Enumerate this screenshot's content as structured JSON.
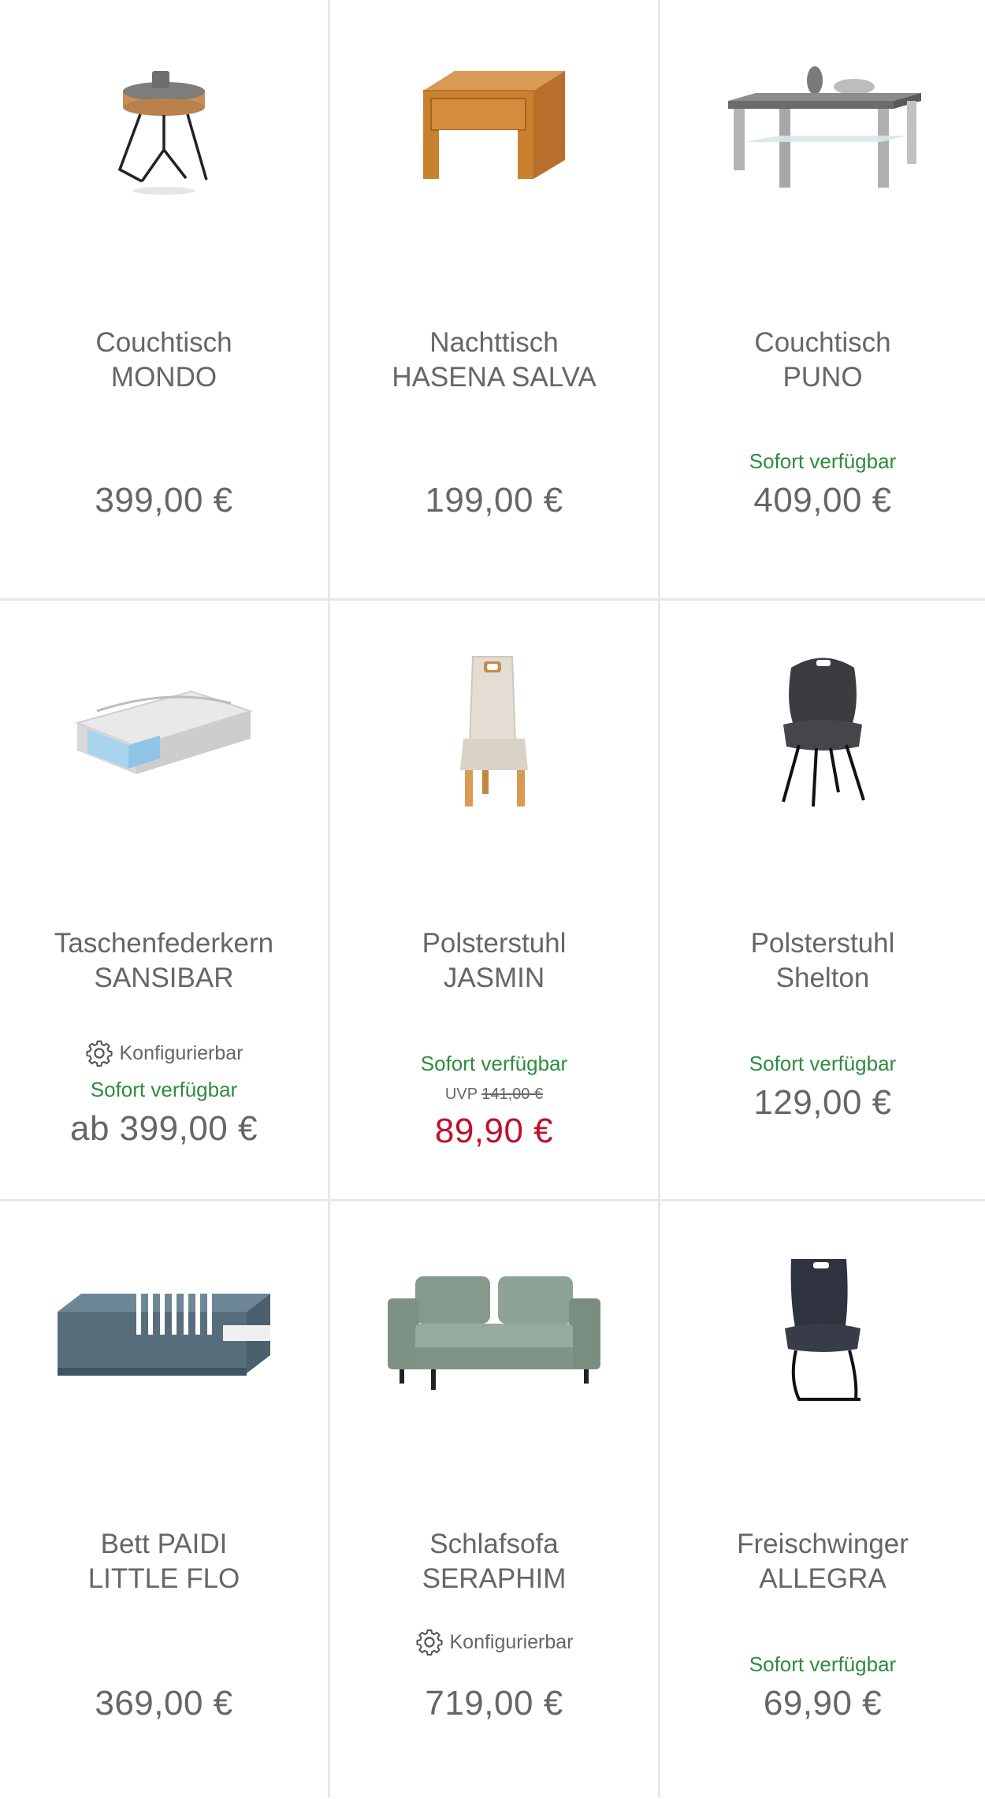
{
  "products": [
    {
      "title_line1": "Couchtisch",
      "title_line2": "MONDO",
      "configurable": "",
      "stock": "",
      "uvp_label": "",
      "uvp_value": "",
      "price": "399,00 €",
      "sale": false,
      "icon": "round-side-table-icon"
    },
    {
      "title_line1": "Nachttisch",
      "title_line2": "HASENA SALVA",
      "configurable": "",
      "stock": "",
      "uvp_label": "",
      "uvp_value": "",
      "price": "199,00 €",
      "sale": false,
      "icon": "wooden-nightstand-icon"
    },
    {
      "title_line1": "Couchtisch",
      "title_line2": "PUNO",
      "configurable": "",
      "stock": "Sofort verfügbar",
      "uvp_label": "",
      "uvp_value": "",
      "price": "409,00 €",
      "sale": false,
      "icon": "glass-coffee-table-icon"
    },
    {
      "title_line1": "Taschenfederkern",
      "title_line2": "SANSIBAR",
      "configurable": "Konfigurierbar",
      "stock": "Sofort verfügbar",
      "uvp_label": "",
      "uvp_value": "",
      "price": "ab 399,00 €",
      "sale": false,
      "icon": "mattress-icon"
    },
    {
      "title_line1": "Polsterstuhl",
      "title_line2": "JASMIN",
      "configurable": "",
      "stock": "Sofort verfügbar",
      "uvp_label": "UVP",
      "uvp_value": "141,00 €",
      "price": "89,90 €",
      "sale": true,
      "icon": "upholstered-chair-icon"
    },
    {
      "title_line1": "Polsterstuhl",
      "title_line2": "Shelton",
      "configurable": "",
      "stock": "Sofort verfügbar",
      "uvp_label": "",
      "uvp_value": "",
      "price": "129,00 €",
      "sale": false,
      "icon": "shell-chair-icon"
    },
    {
      "title_line1": "Bett PAIDI",
      "title_line2": "LITTLE FLO",
      "configurable": "",
      "stock": "",
      "uvp_label": "",
      "uvp_value": "",
      "price": "369,00 €",
      "sale": false,
      "icon": "kids-bed-icon"
    },
    {
      "title_line1": "Schlafsofa",
      "title_line2": "SERAPHIM",
      "configurable": "Konfigurierbar",
      "stock": "",
      "uvp_label": "",
      "uvp_value": "",
      "price": "719,00 €",
      "sale": false,
      "icon": "sofa-icon"
    },
    {
      "title_line1": "Freischwinger",
      "title_line2": "ALLEGRA",
      "configurable": "",
      "stock": "Sofort verfügbar",
      "uvp_label": "",
      "uvp_value": "",
      "price": "69,90 €",
      "sale": false,
      "icon": "cantilever-chair-icon"
    }
  ],
  "colors": {
    "stock_green": "#2e8b3e",
    "sale_red": "#c0102b",
    "text_gray": "#666666",
    "divider": "#e5e8ea"
  }
}
